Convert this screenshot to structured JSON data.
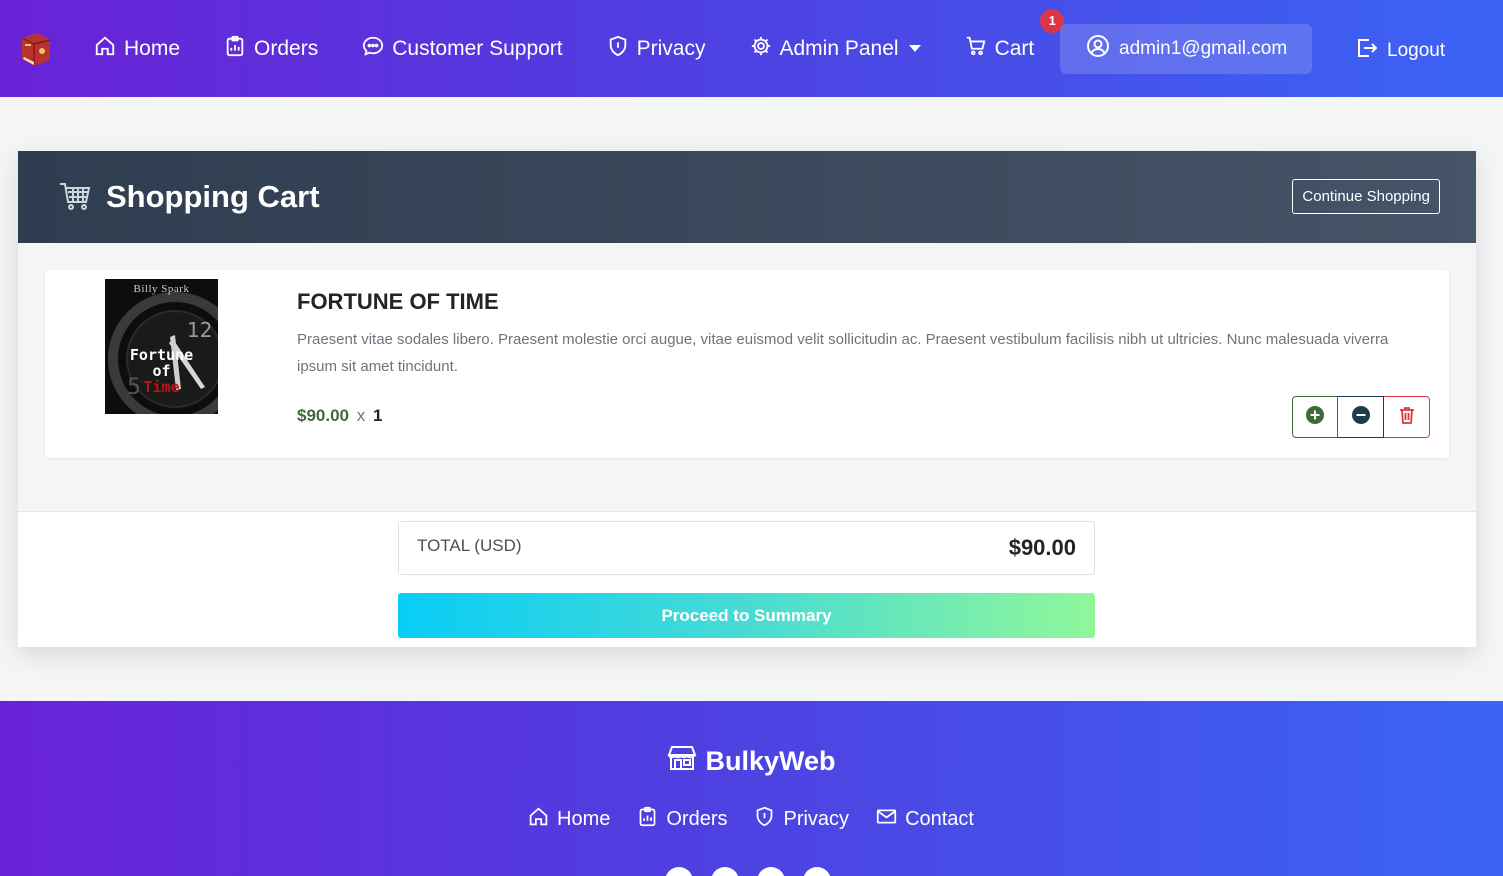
{
  "navbar": {
    "items": [
      {
        "label": "Home",
        "icon": "house-icon"
      },
      {
        "label": "Orders",
        "icon": "clipboard-data-icon"
      },
      {
        "label": "Customer Support",
        "icon": "chat-dots-icon"
      },
      {
        "label": "Privacy",
        "icon": "shield-icon"
      },
      {
        "label": "Admin Panel",
        "icon": "gear-icon"
      },
      {
        "label": "Cart",
        "icon": "cart-icon"
      }
    ],
    "cart_count": "1",
    "user_email": "admin1@gmail.com",
    "logout_label": "Logout"
  },
  "cart": {
    "title": "Shopping Cart",
    "continue_label": "Continue Shopping",
    "items": [
      {
        "name": "FORTUNE OF TIME",
        "description": "Praesent vitae sodales libero. Praesent molestie orci augue, vitae euismod velit sollicitudin ac. Praesent vestibulum facilisis nibh ut ultricies. Nunc malesuada viverra ipsum sit amet tincidunt.",
        "price": "$90.00",
        "times": "x",
        "quantity": "1",
        "cover_author": "Billy Spark",
        "cover_title_1": "Fortune",
        "cover_title_2": "of",
        "cover_title_3": "Time"
      }
    ],
    "total_label": "TOTAL (USD)",
    "total_value": "$90.00",
    "proceed_label": "Proceed to Summary"
  },
  "footer": {
    "brand": "BulkyWeb",
    "links": [
      {
        "label": "Home",
        "icon": "house-icon"
      },
      {
        "label": "Orders",
        "icon": "clipboard-data-icon"
      },
      {
        "label": "Privacy",
        "icon": "shield-icon"
      },
      {
        "label": "Contact",
        "icon": "envelope-icon"
      }
    ],
    "social_icons": [
      "facebook-icon",
      "x-twitter-icon",
      "instagram-icon",
      "linkedin-icon"
    ]
  },
  "colors": {
    "nav_gradient_start": "#6a22d6",
    "nav_gradient_end": "#3b64f4",
    "card_header": "#2e3d4f",
    "price_green": "#3f6b3c",
    "danger": "#dc3545",
    "proceed_start": "#08cdf6",
    "proceed_end": "#90f79a"
  }
}
